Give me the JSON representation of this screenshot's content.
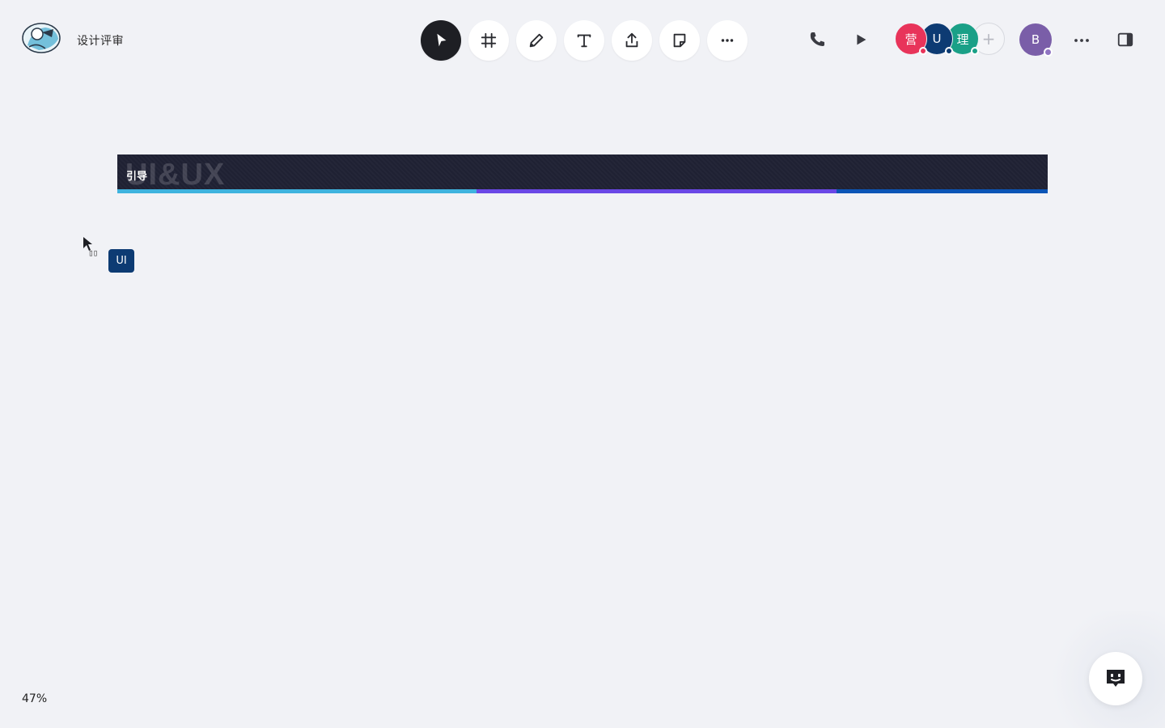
{
  "header": {
    "board_title": "设计评审",
    "logo_icon": "board-logo-icon"
  },
  "toolbar": {
    "tools": [
      {
        "name": "select",
        "icon": "pointer-icon",
        "active": true
      },
      {
        "name": "frame",
        "icon": "frame-icon",
        "active": false
      },
      {
        "name": "pen",
        "icon": "pencil-icon",
        "active": false
      },
      {
        "name": "text",
        "icon": "text-icon",
        "active": false
      },
      {
        "name": "upload",
        "icon": "upload-icon",
        "active": false
      },
      {
        "name": "sticky-note",
        "icon": "sticky-note-icon",
        "active": false
      },
      {
        "name": "more",
        "icon": "more-horizontal-icon",
        "active": false
      }
    ]
  },
  "collaborators": [
    {
      "initial": "营",
      "color": "#e8345a",
      "status_color": "#e8345a"
    },
    {
      "initial": "U",
      "color": "#0d3b73",
      "status_color": "#0d3b73"
    },
    {
      "initial": "理",
      "color": "#1aa087",
      "status_color": "#1aa087"
    }
  ],
  "add_collaborator": "+",
  "current_user": {
    "initial": "B",
    "color": "#7a5ea8"
  },
  "banner": {
    "watermark": "UI&UX",
    "label": "引导",
    "stripe_colors": [
      "#3fb3de",
      "#6a48e6",
      "#0b55b6"
    ],
    "background": "#1f2133"
  },
  "remote_cursor": {
    "glyph": "▯▯",
    "tag": "UI",
    "tag_color": "#0d3b73"
  },
  "zoom": "47%"
}
